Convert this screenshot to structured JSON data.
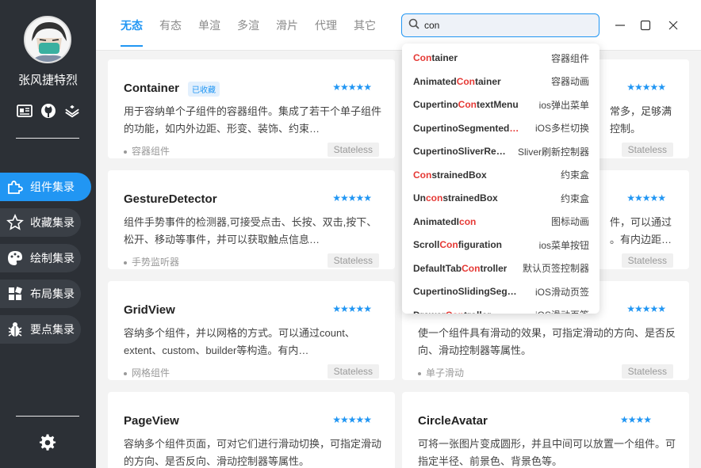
{
  "user": {
    "name": "张风捷特烈"
  },
  "nav": [
    {
      "label": "组件集录",
      "icon": "puzzle-icon",
      "active": true
    },
    {
      "label": "收藏集录",
      "icon": "star-icon"
    },
    {
      "label": "绘制集录",
      "icon": "palette-icon"
    },
    {
      "label": "布局集录",
      "icon": "grid-icon"
    },
    {
      "label": "要点集录",
      "icon": "bug-icon"
    }
  ],
  "tabs": [
    "无态",
    "有态",
    "单渲",
    "多渲",
    "滑片",
    "代理",
    "其它"
  ],
  "search": {
    "value": "con"
  },
  "cards": [
    {
      "title": "Container",
      "badge": "已收藏",
      "desc": "用于容纳单个子组件的容器组件。集成了若干个单子组件的功能，如内外边距、形变、装饰、约束…",
      "category": "容器组件",
      "tag": "Stateless"
    },
    {
      "title": "",
      "desc": "常多，足够满",
      "desc2": "控制。",
      "category": "",
      "tag": "Stateless"
    },
    {
      "title": "GestureDetector",
      "desc": "组件手势事件的检测器,可接受点击、长按、双击,按下、松开、移动等事件，并可以获取触点信息…",
      "category": "手势监听器",
      "tag": "Stateless"
    },
    {
      "title": "",
      "desc": "件，可以通过",
      "desc2": "。有内边距…",
      "category": "",
      "tag": "Stateless"
    },
    {
      "title": "GridView",
      "desc": "容纳多个组件，并以网格的方式。可以通过count、extent、custom、builder等构造。有内…",
      "category": "网格组件",
      "tag": "Stateless"
    },
    {
      "title": "",
      "desc": "使一个组件具有滑动的效果，可指定滑动的方向、是否反向、滑动控制器等属性。",
      "category": "单子滑动",
      "tag": "Stateless"
    },
    {
      "title": "PageView",
      "desc": "容纳多个组件页面，可对它们进行滑动切换，可指定滑动的方向、是否反向、滑动控制器等属性。",
      "category": "",
      "tag": ""
    },
    {
      "title": "CircleAvatar",
      "desc": "可将一张图片变成圆形，并且中间可以放置一个组件。可指定半径、前景色、背景色等。",
      "category": "",
      "tag": ""
    }
  ],
  "dropdown": [
    {
      "pre": "",
      "hl": "Con",
      "post": "tainer",
      "desc": "容器组件"
    },
    {
      "pre": "Animated",
      "hl": "Con",
      "post": "tainer",
      "desc": "容器动画"
    },
    {
      "pre": "Cupertino",
      "hl": "Con",
      "post": "textMenu",
      "desc": "ios弹出菜单"
    },
    {
      "pre": "CupertinoSegmented",
      "hl": "…",
      "post": "",
      "desc": "iOS多栏切换"
    },
    {
      "pre": "CupertinoSliverRe…",
      "hl": "",
      "post": "",
      "desc": "Sliver刷新控制器"
    },
    {
      "pre": "",
      "hl": "Con",
      "post": "strainedBox",
      "desc": "约束盒"
    },
    {
      "pre": "Un",
      "hl": "con",
      "post": "strainedBox",
      "desc": "约束盒"
    },
    {
      "pre": "AnimatedI",
      "hl": "con",
      "post": "",
      "desc": "图标动画"
    },
    {
      "pre": "Scroll",
      "hl": "Con",
      "post": "figuration",
      "desc": "ios菜单按钮"
    },
    {
      "pre": "DefaultTab",
      "hl": "Con",
      "post": "troller",
      "desc": "默认页签控制器"
    },
    {
      "pre": "CupertinoSlidingSeg…",
      "hl": "",
      "post": "",
      "desc": "iOS滑动页签"
    },
    {
      "pre": "Drawer",
      "hl": "Con",
      "post": "troller",
      "desc": "iOS滑动页签"
    }
  ],
  "colors": {
    "accent": "#2196f3",
    "sidebar": "#2c3036",
    "highlight": "#e53935"
  }
}
